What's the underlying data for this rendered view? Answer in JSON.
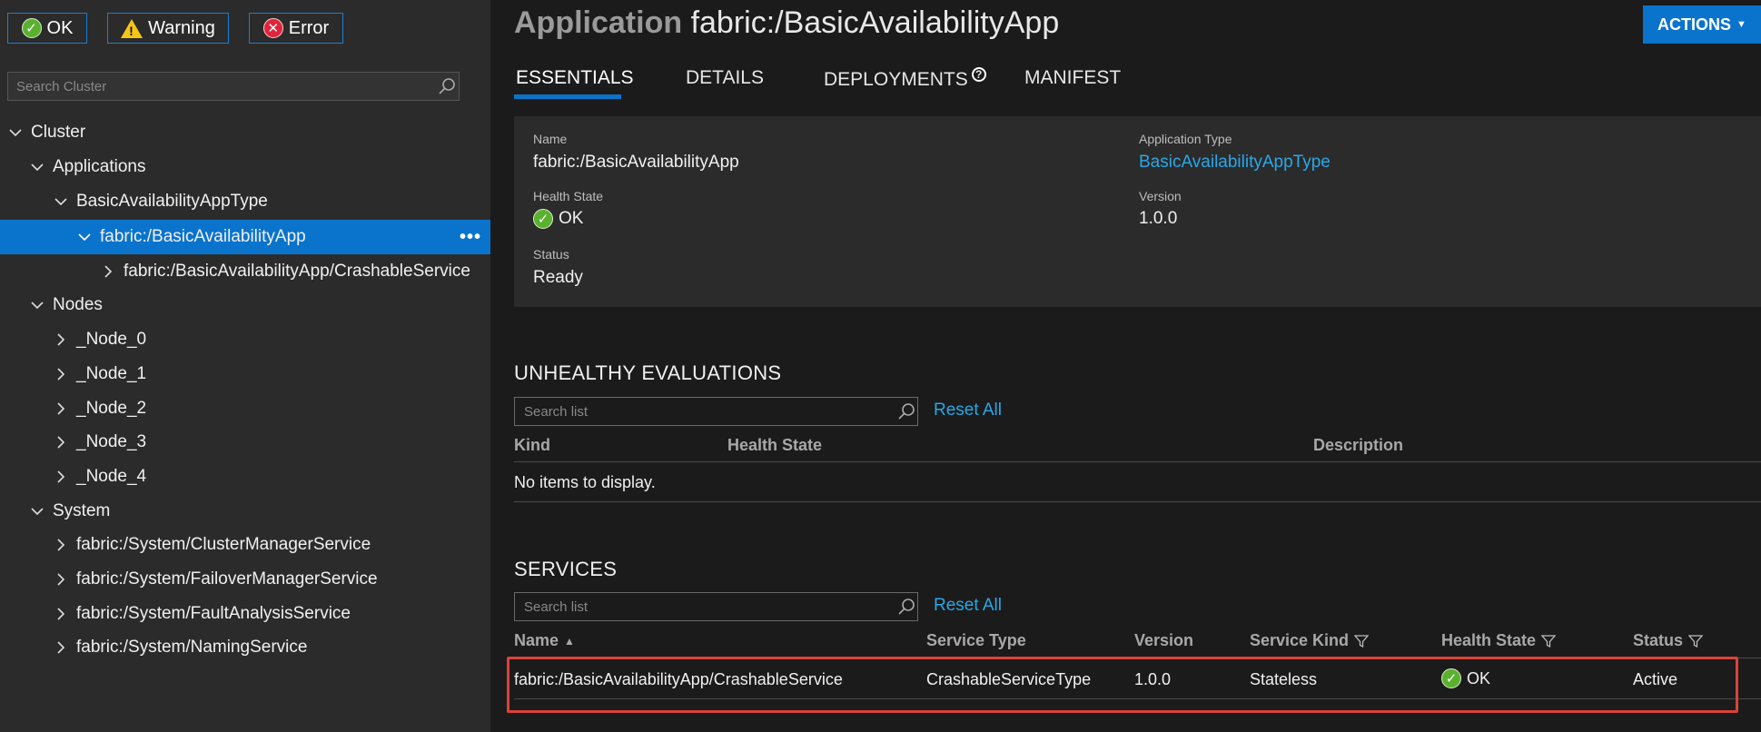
{
  "filters": {
    "ok": "OK",
    "warning": "Warning",
    "error": "Error"
  },
  "search": {
    "placeholder": "Search Cluster"
  },
  "tree": {
    "cluster": "Cluster",
    "applications": "Applications",
    "app_type": "BasicAvailabilityAppType",
    "app": "fabric:/BasicAvailabilityApp",
    "app_more": "•••",
    "service": "fabric:/BasicAvailabilityApp/CrashableService",
    "nodes": "Nodes",
    "node_items": [
      "_Node_0",
      "_Node_1",
      "_Node_2",
      "_Node_3",
      "_Node_4"
    ],
    "system": "System",
    "system_items": [
      "fabric:/System/ClusterManagerService",
      "fabric:/System/FailoverManagerService",
      "fabric:/System/FaultAnalysisService",
      "fabric:/System/NamingService"
    ]
  },
  "header": {
    "keyword": "Application",
    "name": "fabric:/BasicAvailabilityApp",
    "actions": "ACTIONS"
  },
  "tabs": {
    "essentials": "ESSENTIALS",
    "details": "DETAILS",
    "deployments": "DEPLOYMENTS",
    "manifest": "MANIFEST"
  },
  "essentials": {
    "name_label": "Name",
    "name_value": "fabric:/BasicAvailabilityApp",
    "app_type_label": "Application Type",
    "app_type_value": "BasicAvailabilityAppType",
    "health_label": "Health State",
    "health_value": "OK",
    "version_label": "Version",
    "version_value": "1.0.0",
    "status_label": "Status",
    "status_value": "Ready"
  },
  "unhealthy": {
    "title": "UNHEALTHY EVALUATIONS",
    "search_placeholder": "Search list",
    "reset": "Reset All",
    "columns": {
      "kind": "Kind",
      "health_state": "Health State",
      "description": "Description"
    },
    "empty": "No items to display."
  },
  "services": {
    "title": "SERVICES",
    "search_placeholder": "Search list",
    "reset": "Reset All",
    "columns": {
      "name": "Name",
      "service_type": "Service Type",
      "version": "Version",
      "service_kind": "Service Kind",
      "health_state": "Health State",
      "status": "Status"
    },
    "row": {
      "name": "fabric:/BasicAvailabilityApp/CrashableService",
      "service_type": "CrashableServiceType",
      "version": "1.0.0",
      "service_kind": "Stateless",
      "health_state": "OK",
      "status": "Active"
    }
  },
  "colors": {
    "accent": "#0a74cc",
    "link": "#2aa7e8",
    "ok": "#5bb12f",
    "error": "#e0243c",
    "warning": "#f5c518",
    "highlight": "#d9433a"
  }
}
